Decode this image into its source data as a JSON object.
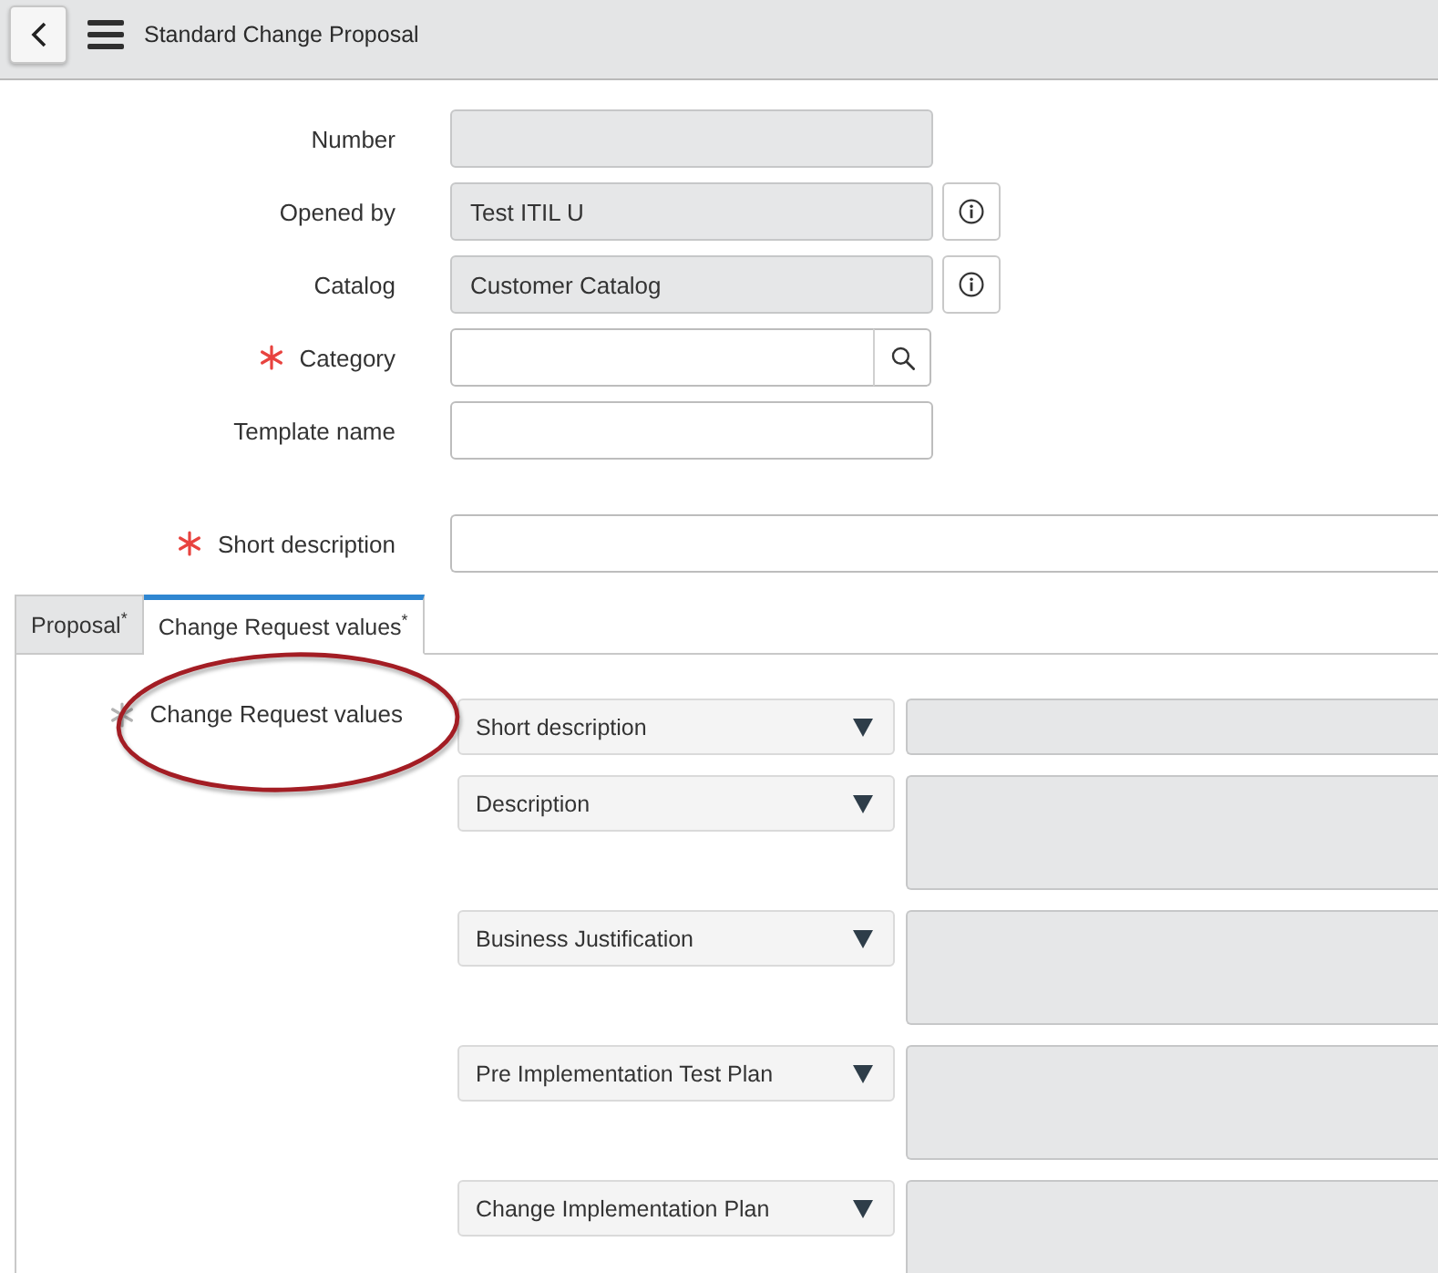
{
  "header": {
    "title": "Standard Change Proposal"
  },
  "fields": [
    {
      "label": "Number",
      "kind": "readonly",
      "required": false,
      "info": false
    },
    {
      "label": "Opened by",
      "kind": "readonly",
      "value": "Test ITIL U",
      "required": false,
      "info": true
    },
    {
      "label": "Catalog",
      "kind": "readonly",
      "value": "Customer Catalog",
      "required": false,
      "info": true
    },
    {
      "label": "Category",
      "kind": "reference",
      "required": true,
      "info": false
    },
    {
      "label": "Template name",
      "kind": "text",
      "required": false,
      "info": false
    }
  ],
  "short_description": {
    "label": "Short description",
    "required": true
  },
  "tabs": [
    {
      "label": "Proposal$^{*}$",
      "selected": false
    },
    {
      "label": "Change Request values$^{*}$",
      "selected": true
    }
  ],
  "section": {
    "label": "Change Request values",
    "required": true,
    "satisfied": true,
    "rows": [
      {
        "field": "Short description",
        "kind": "single",
        "readonly": true
      },
      {
        "field": "Description",
        "kind": "multi",
        "readonly": true
      },
      {
        "field": "Business Justification",
        "kind": "multi",
        "readonly": true
      },
      {
        "field": "Pre Implementation Test Plan",
        "kind": "multi",
        "readonly": true
      },
      {
        "field": "Change Implementation Plan",
        "kind": "multi",
        "readonly": true
      }
    ]
  }
}
